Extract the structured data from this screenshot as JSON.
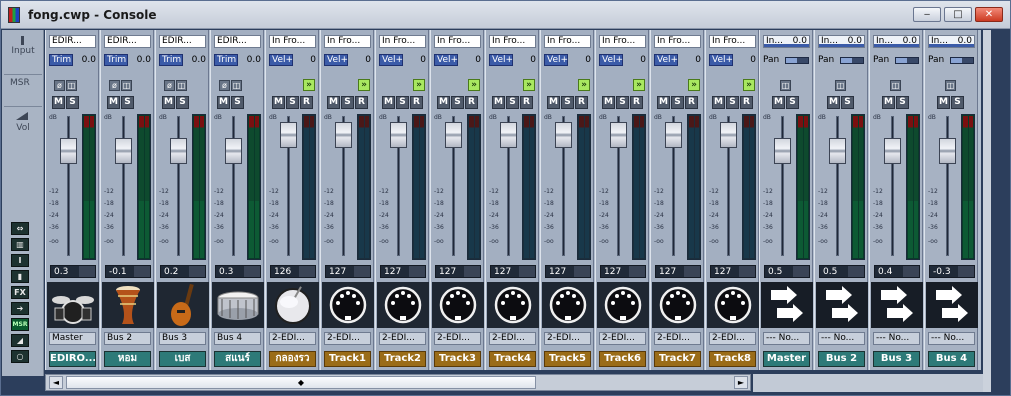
{
  "window": {
    "title": "fong.cwp - Console",
    "minimize_label": "‒",
    "maximize_label": "□",
    "close_label": "✕"
  },
  "left_panel": {
    "input_label": "Input",
    "msr_label": "MSR",
    "vol_label": "Vol",
    "tool_buttons": [
      {
        "name": "width-toggle-icon",
        "glyph": "⇔"
      },
      {
        "name": "meter-toggle-icon",
        "glyph": "▥"
      },
      {
        "name": "input-toggle-icon",
        "glyph": "I"
      },
      {
        "name": "aux-toggle-icon",
        "glyph": "▮"
      },
      {
        "name": "fx-toggle-icon",
        "glyph": "FX"
      },
      {
        "name": "send-toggle-icon",
        "glyph": "➔"
      },
      {
        "name": "msr-toggle-icon",
        "glyph": "MSR"
      },
      {
        "name": "volume-toggle-icon",
        "glyph": "◢"
      },
      {
        "name": "output-toggle-icon",
        "glyph": "○"
      }
    ]
  },
  "db_scale": [
    "dB",
    "-12",
    "-18",
    "-24",
    "-36",
    "-oo"
  ],
  "strips": [
    {
      "input": "EDIR...",
      "row": "Trim",
      "row_value": "0.0",
      "vol": "0.3",
      "output": "Master",
      "name": "EDIRO...",
      "icon": "drum-kit",
      "name_color": "teal",
      "midi": false
    },
    {
      "input": "EDIR...",
      "row": "Trim",
      "row_value": "0.0",
      "vol": "-0.1",
      "output": "Bus 2",
      "name": "หอม",
      "icon": "djembe",
      "name_color": "teal",
      "midi": false
    },
    {
      "input": "EDIR...",
      "row": "Trim",
      "row_value": "0.0",
      "vol": "0.2",
      "output": "Bus 3",
      "name": "เบส",
      "icon": "bass-guitar",
      "name_color": "teal",
      "midi": false
    },
    {
      "input": "EDIR...",
      "row": "Trim",
      "row_value": "0.0",
      "vol": "0.3",
      "output": "Bus 4",
      "name": "สแนร์",
      "icon": "snare",
      "name_color": "teal",
      "midi": false
    },
    {
      "input": "In Fro...",
      "row": "Vel+",
      "row_value": "0",
      "vol": "126",
      "output": "2-EDI...",
      "name": "กลองรว",
      "icon": "drum-small",
      "name_color": "gold",
      "midi": true
    },
    {
      "input": "In Fro...",
      "row": "Vel+",
      "row_value": "0",
      "vol": "127",
      "output": "2-EDI...",
      "name": "Track1",
      "icon": "midi",
      "name_color": "gold",
      "midi": true
    },
    {
      "input": "In Fro...",
      "row": "Vel+",
      "row_value": "0",
      "vol": "127",
      "output": "2-EDI...",
      "name": "Track2",
      "icon": "midi",
      "name_color": "gold",
      "midi": true
    },
    {
      "input": "In Fro...",
      "row": "Vel+",
      "row_value": "0",
      "vol": "127",
      "output": "2-EDI...",
      "name": "Track3",
      "icon": "midi",
      "name_color": "gold",
      "midi": true
    },
    {
      "input": "In Fro...",
      "row": "Vel+",
      "row_value": "0",
      "vol": "127",
      "output": "2-EDI...",
      "name": "Track4",
      "icon": "midi",
      "name_color": "gold",
      "midi": true
    },
    {
      "input": "In Fro...",
      "row": "Vel+",
      "row_value": "0",
      "vol": "127",
      "output": "2-EDI...",
      "name": "Track5",
      "icon": "midi",
      "name_color": "gold",
      "midi": true
    },
    {
      "input": "In Fro...",
      "row": "Vel+",
      "row_value": "0",
      "vol": "127",
      "output": "2-EDI...",
      "name": "Track6",
      "icon": "midi",
      "name_color": "gold",
      "midi": true
    },
    {
      "input": "In Fro...",
      "row": "Vel+",
      "row_value": "0",
      "vol": "127",
      "output": "2-EDI...",
      "name": "Track7",
      "icon": "midi",
      "name_color": "gold",
      "midi": true
    },
    {
      "input": "In Fro...",
      "row": "Vel+",
      "row_value": "0",
      "vol": "127",
      "output": "2-EDI...",
      "name": "Track8",
      "icon": "midi",
      "name_color": "gold",
      "midi": true
    }
  ],
  "buses": [
    {
      "input": "In...",
      "input_value": "0.0",
      "row": "Pan",
      "pan": 0.0,
      "vol": "0.5",
      "output": "--- No...",
      "name": "Master"
    },
    {
      "input": "In...",
      "input_value": "0.0",
      "row": "Pan",
      "pan": 0.0,
      "vol": "0.5",
      "output": "--- No...",
      "name": "Bus 2"
    },
    {
      "input": "In...",
      "input_value": "0.0",
      "row": "Pan",
      "pan": 0.0,
      "vol": "0.4",
      "output": "--- No...",
      "name": "Bus 3"
    },
    {
      "input": "In...",
      "input_value": "0.0",
      "row": "Pan",
      "pan": 0.0,
      "vol": "-0.3",
      "output": "--- No...",
      "name": "Bus 4"
    }
  ],
  "buttons": {
    "mute": "M",
    "solo": "S",
    "record": "R",
    "phase": "ø",
    "interleave": "◫"
  },
  "scroll": {
    "left_arrow": "◄",
    "right_arrow": "►",
    "thumb_grip": "◆"
  }
}
